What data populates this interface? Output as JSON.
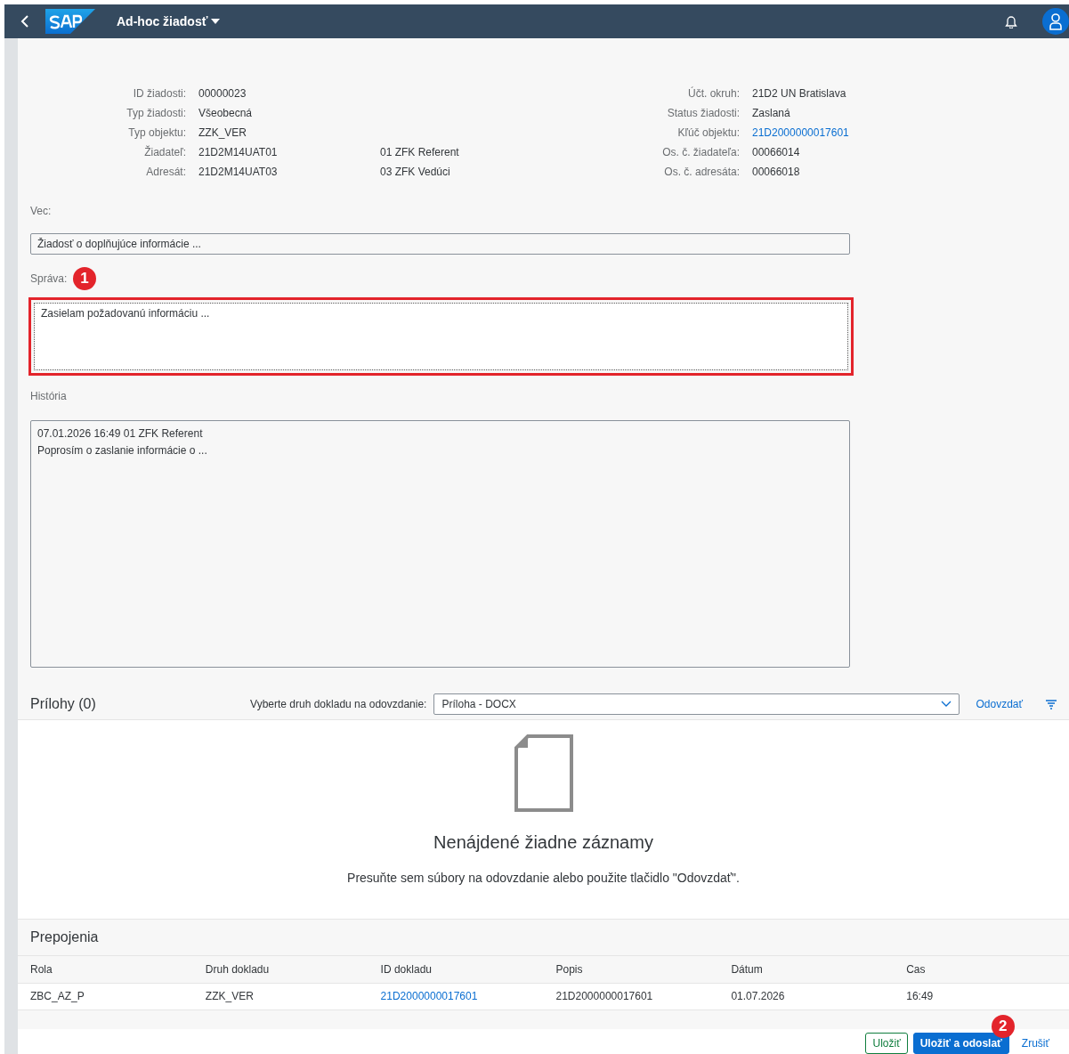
{
  "shell": {
    "title": "Ad-hoc žiadosť"
  },
  "details": {
    "left": [
      {
        "label": "ID žiadosti:",
        "value": "00000023"
      },
      {
        "label": "Typ žiadosti:",
        "value": "Všeobecná"
      },
      {
        "label": "Typ objektu:",
        "value": "ZZK_VER"
      },
      {
        "label": "Žiadateľ:",
        "value": "21D2M14UAT01",
        "note": "01 ZFK Referent"
      },
      {
        "label": "Adresát:",
        "value": "21D2M14UAT03",
        "note": "03 ZFK Vedúci"
      }
    ],
    "right": [
      {
        "label": "Účt. okruh:",
        "value": "21D2 UN Bratislava",
        "kind": "text"
      },
      {
        "label": "Status žiadosti:",
        "value": "Zaslaná",
        "kind": "text"
      },
      {
        "label": "Kľúč objektu:",
        "value": "21D2000000017601",
        "kind": "link"
      },
      {
        "label": "Os. č. žiadateľa:",
        "value": "00066014",
        "kind": "text"
      },
      {
        "label": "Os. č. adresáta:",
        "value": "00066018",
        "kind": "text"
      }
    ]
  },
  "subject": {
    "label": "Vec:",
    "value": "Žiadosť o doplňujúce informácie ..."
  },
  "message": {
    "label": "Správa:",
    "value": "Zasielam požadovanú informáciu ...",
    "highlighted": true,
    "callout": "1"
  },
  "history": {
    "label": "História",
    "entries": [
      {
        "header": "07.01.2026 16:49 01 ZFK Referent",
        "text": "Poprosím o zaslanie informácie o ..."
      }
    ]
  },
  "attachments": {
    "title": "Prílohy (0)",
    "doc_type_label": "Vyberte druh dokladu na odovzdanie:",
    "doc_type": "Príloha - DOCX",
    "upload": "Odovzdať",
    "empty_title": "Nenájdené žiadne záznamy",
    "empty_text": "Presuňte sem súbory na odovzdanie alebo použite tlačidlo \"Odovzdať\"."
  },
  "links": {
    "title": "Prepojenia",
    "columns": [
      "Rola",
      "Druh dokladu",
      "ID dokladu",
      "Popis",
      "Dátum",
      "Cas"
    ],
    "rows": [
      {
        "cells": [
          {
            "text": "ZBC_AZ_P",
            "kind": "text"
          },
          {
            "text": "ZZK_VER",
            "kind": "text"
          },
          {
            "text": "21D2000000017601",
            "kind": "link"
          },
          {
            "text": "21D2000000017601",
            "kind": "text"
          },
          {
            "text": "01.07.2026",
            "kind": "text"
          },
          {
            "text": "16:49",
            "kind": "text"
          }
        ]
      }
    ]
  },
  "footer": {
    "buttons": [
      {
        "label": "Uložiť",
        "kind": "secondary"
      },
      {
        "label": "Uložiť a odoslať",
        "kind": "primary",
        "callout": "2"
      },
      {
        "label": "Zrušiť",
        "kind": "transparent"
      }
    ]
  }
}
